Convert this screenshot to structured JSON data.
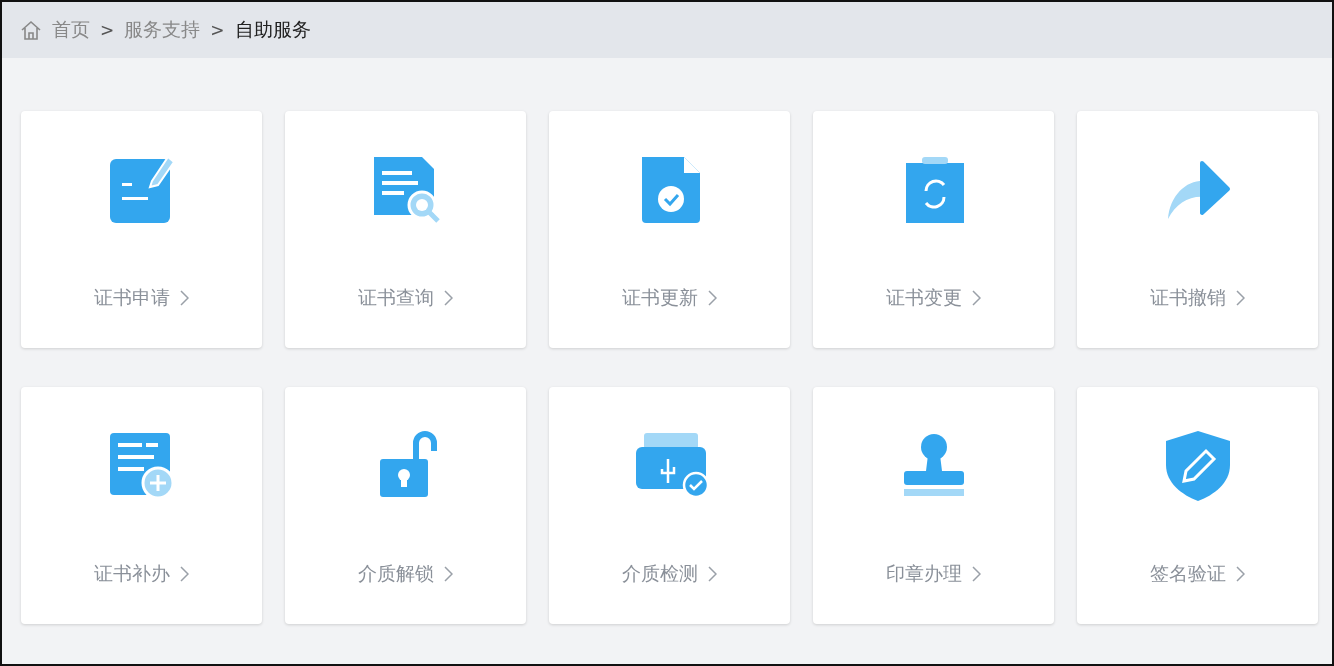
{
  "breadcrumb": [
    {
      "label": "首页",
      "current": false
    },
    {
      "label": "服务支持",
      "current": false
    },
    {
      "label": "自助服务",
      "current": true
    }
  ],
  "separator": ">",
  "services": [
    {
      "label": "证书申请",
      "kind": "apply"
    },
    {
      "label": "证书查询",
      "kind": "query"
    },
    {
      "label": "证书更新",
      "kind": "renew"
    },
    {
      "label": "证书变更",
      "kind": "change"
    },
    {
      "label": "证书撤销",
      "kind": "revoke"
    },
    {
      "label": "证书补办",
      "kind": "reissue"
    },
    {
      "label": "介质解锁",
      "kind": "unlock"
    },
    {
      "label": "介质检测",
      "kind": "detect"
    },
    {
      "label": "印章办理",
      "kind": "seal"
    },
    {
      "label": "签名验证",
      "kind": "verify"
    }
  ]
}
